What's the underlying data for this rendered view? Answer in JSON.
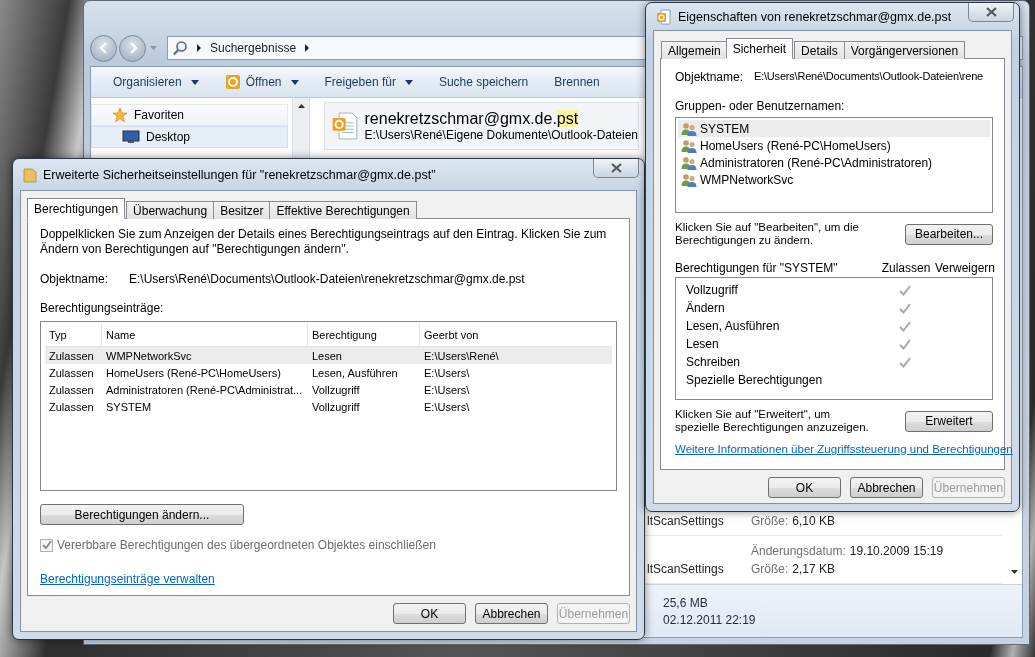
{
  "explorer": {
    "breadcrumb": "Suchergebnisse",
    "toolbar": [
      {
        "label": "Organisieren",
        "icon": false,
        "dropdown": true
      },
      {
        "label": "Öffnen",
        "icon": true,
        "dropdown": true
      },
      {
        "label": "Freigeben für",
        "icon": false,
        "dropdown": true
      },
      {
        "label": "Suche speichern",
        "icon": false,
        "dropdown": false
      },
      {
        "label": "Brennen",
        "icon": false,
        "dropdown": false
      }
    ],
    "nav": [
      {
        "label": "Favoriten",
        "kind": "group",
        "selected": false
      },
      {
        "label": "Desktop",
        "kind": "desktop",
        "selected": true
      }
    ],
    "result": {
      "name": "renekretzschmar@gmx.de.**pst**",
      "path": "E:\\Users\\René\\Eigene Dokumente\\Outlook-Dateien"
    },
    "files": [
      {
        "name": "ltScanSettings",
        "fields": [
          {
            "label": "Größe:",
            "value": "6,10 KB"
          }
        ]
      },
      {
        "name": "ltScanSettings",
        "fields": [
          {
            "label": "Änderungsdatum:",
            "value": "19.10.2009 15:19"
          },
          {
            "label": "Größe:",
            "value": "2,17 KB"
          }
        ]
      }
    ],
    "details": [
      "25,6 MB",
      "02.12.2011 22:19"
    ]
  },
  "advanced": {
    "title": "Erweiterte Sicherheitseinstellungen für \"renekretzschmar@gmx.de.pst\"",
    "tabs": [
      {
        "label": "Berechtigungen",
        "selected": true
      },
      {
        "label": "Überwachung",
        "selected": false
      },
      {
        "label": "Besitzer",
        "selected": false
      },
      {
        "label": "Effektive Berechtigungen",
        "selected": false
      }
    ],
    "description": "Doppelklicken Sie zum Anzeigen der Details eines Berechtigungseintrags auf den Eintrag. Klicken Sie zum Ändern von Berechtigungen auf \"Berechtigungen ändern\".",
    "object_label": "Objektname:",
    "object_value": "E:\\Users\\René\\Documents\\Outlook-Dateien\\renekretzschmar@gmx.de.pst",
    "entries_label": "Berechtigungseinträge:",
    "columns": [
      "Typ",
      "Name",
      "Berechtigung",
      "Geerbt von"
    ],
    "rows": [
      {
        "cells": [
          "Zulassen",
          "WMPNetworkSvc",
          "Lesen",
          "E:\\Users\\René\\"
        ],
        "selected": true
      },
      {
        "cells": [
          "Zulassen",
          "HomeUsers (René-PC\\HomeUsers)",
          "Lesen, Ausführen",
          "E:\\Users\\"
        ],
        "selected": false
      },
      {
        "cells": [
          "Zulassen",
          "Administratoren (René-PC\\Administrat...",
          "Vollzugriff",
          "E:\\Users\\"
        ],
        "selected": false
      },
      {
        "cells": [
          "Zulassen",
          "SYSTEM",
          "Vollzugriff",
          "E:\\Users\\"
        ],
        "selected": false
      }
    ],
    "change_button": "Berechtigungen ändern...",
    "inherit": {
      "label": "Vererbbare Berechtigungen des übergeordneten Objektes einschließen",
      "checked": true,
      "disabled": true
    },
    "link": "Berechtigungseinträge verwalten",
    "buttons": [
      {
        "label": "OK",
        "disabled": false
      },
      {
        "label": "Abbrechen",
        "disabled": false
      },
      {
        "label": "Übernehmen",
        "disabled": true
      }
    ]
  },
  "properties": {
    "title": "Eigenschaften von renekretzschmar@gmx.de.pst",
    "tabs": [
      {
        "label": "Allgemein",
        "selected": false
      },
      {
        "label": "Sicherheit",
        "selected": true
      },
      {
        "label": "Details",
        "selected": false
      },
      {
        "label": "Vorgängerversionen",
        "selected": false
      }
    ],
    "object_label": "Objektname:",
    "object_value": "E:\\Users\\René\\Documents\\Outlook-Dateien\\rene",
    "groups_label": "Gruppen- oder Benutzernamen:",
    "groups": [
      {
        "name": "SYSTEM",
        "selected": true
      },
      {
        "name": "HomeUsers (René-PC\\HomeUsers)",
        "selected": false
      },
      {
        "name": "Administratoren (René-PC\\Administratoren)",
        "selected": false
      },
      {
        "name": "WMPNetworkSvc",
        "selected": false
      }
    ],
    "edit_hint": "Klicken Sie auf \"Bearbeiten\", um die Berechtigungen zu ändern.",
    "edit_button": "Bearbeiten...",
    "permissions_label": "Berechtigungen für \"SYSTEM\"",
    "permission_columns": [
      "Zulassen",
      "Verweigern"
    ],
    "permissions": [
      {
        "name": "Vollzugriff",
        "allow": true,
        "deny": false
      },
      {
        "name": "Ändern",
        "allow": true,
        "deny": false
      },
      {
        "name": "Lesen, Ausführen",
        "allow": true,
        "deny": false
      },
      {
        "name": "Lesen",
        "allow": true,
        "deny": false
      },
      {
        "name": "Schreiben",
        "allow": true,
        "deny": false
      },
      {
        "name": "Spezielle Berechtigungen",
        "allow": false,
        "deny": false
      }
    ],
    "advanced_hint": "Klicken Sie auf \"Erweitert\", um spezielle Berechtigungen anzuzeigen.",
    "advanced_button": "Erweitert",
    "link": "Weitere Informationen über Zugriffssteuerung und Berechtigungen",
    "buttons": [
      {
        "label": "OK",
        "disabled": false
      },
      {
        "label": "Abbrechen",
        "disabled": false
      },
      {
        "label": "Übernehmen",
        "disabled": true
      }
    ]
  }
}
